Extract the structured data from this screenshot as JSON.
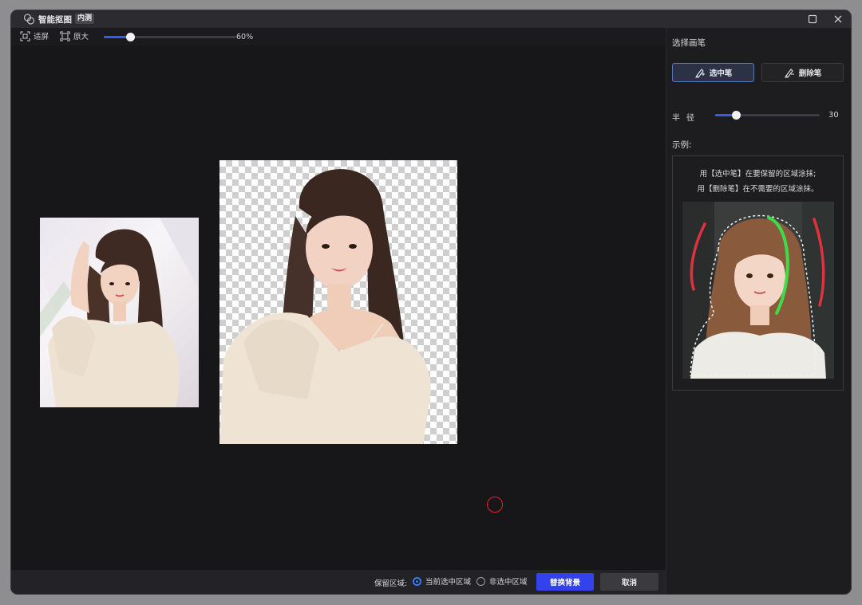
{
  "window": {
    "title": "智能抠图",
    "badge": "内测"
  },
  "toolbar": {
    "restore_label": "适屏",
    "original_size_label": "原大",
    "zoom_percent": 60,
    "zoom_text": "60%"
  },
  "canvas": {
    "original_image_alt": "原图",
    "cutout_image_alt": "抠图结果"
  },
  "footer": {
    "keep_area_label": "保留区域:",
    "options": [
      {
        "label": "当前选中区域",
        "selected": true
      },
      {
        "label": "非选中区域",
        "selected": false
      }
    ],
    "replace_bg_button": "替换背景",
    "cancel_button": "取消"
  },
  "panel": {
    "title": "选择画笔",
    "brushes": [
      {
        "label": "选中笔",
        "active": true
      },
      {
        "label": "删除笔",
        "active": false
      }
    ],
    "radius_label": "半径",
    "radius_value": 30,
    "radius_min": 0,
    "radius_max": 150,
    "example_label": "示例:",
    "example_lines": [
      "用【选中笔】在要保留的区域涂抹;",
      "用【删除笔】在不需要的区域涂抹。"
    ]
  },
  "colors": {
    "accent": "#3442ee",
    "slider_fill": "#3b58f0",
    "select_stroke": "#3ddc4a",
    "erase_stroke": "#e0323c",
    "brush_cursor": "#e0232a"
  }
}
